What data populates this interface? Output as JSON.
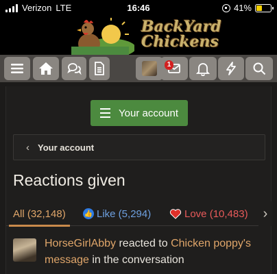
{
  "status_bar": {
    "carrier": "Verizon",
    "network": "LTE",
    "time": "16:46",
    "battery": "41%",
    "battery_level": 0.41
  },
  "header": {
    "logo_line1": "BackYard",
    "logo_line2": "Chickens"
  },
  "navbar": {
    "notification_count": "1",
    "icons": [
      "menu-icon",
      "home-icon",
      "chat-icon",
      "document-icon",
      "avatar",
      "inbox-icon",
      "bell-icon",
      "bolt-icon",
      "search-icon"
    ]
  },
  "account_button": {
    "label": "Your account"
  },
  "breadcrumb": {
    "label": "Your account"
  },
  "page_title": "Reactions given",
  "tabs": {
    "all": "All (32,148)",
    "like": "Like (5,294)",
    "love": "Love (10,483)"
  },
  "activity": {
    "user": "HorseGirlAbby",
    "verb": " reacted to ",
    "target": "Chicken poppy's message",
    "tail": " in the conversation"
  },
  "colors": {
    "accent_green": "#4c8a3f",
    "link_orange": "#e0a66a",
    "like_blue": "#2d7be5",
    "love_red": "#e85a5a",
    "nav_button": "#8a8681"
  }
}
